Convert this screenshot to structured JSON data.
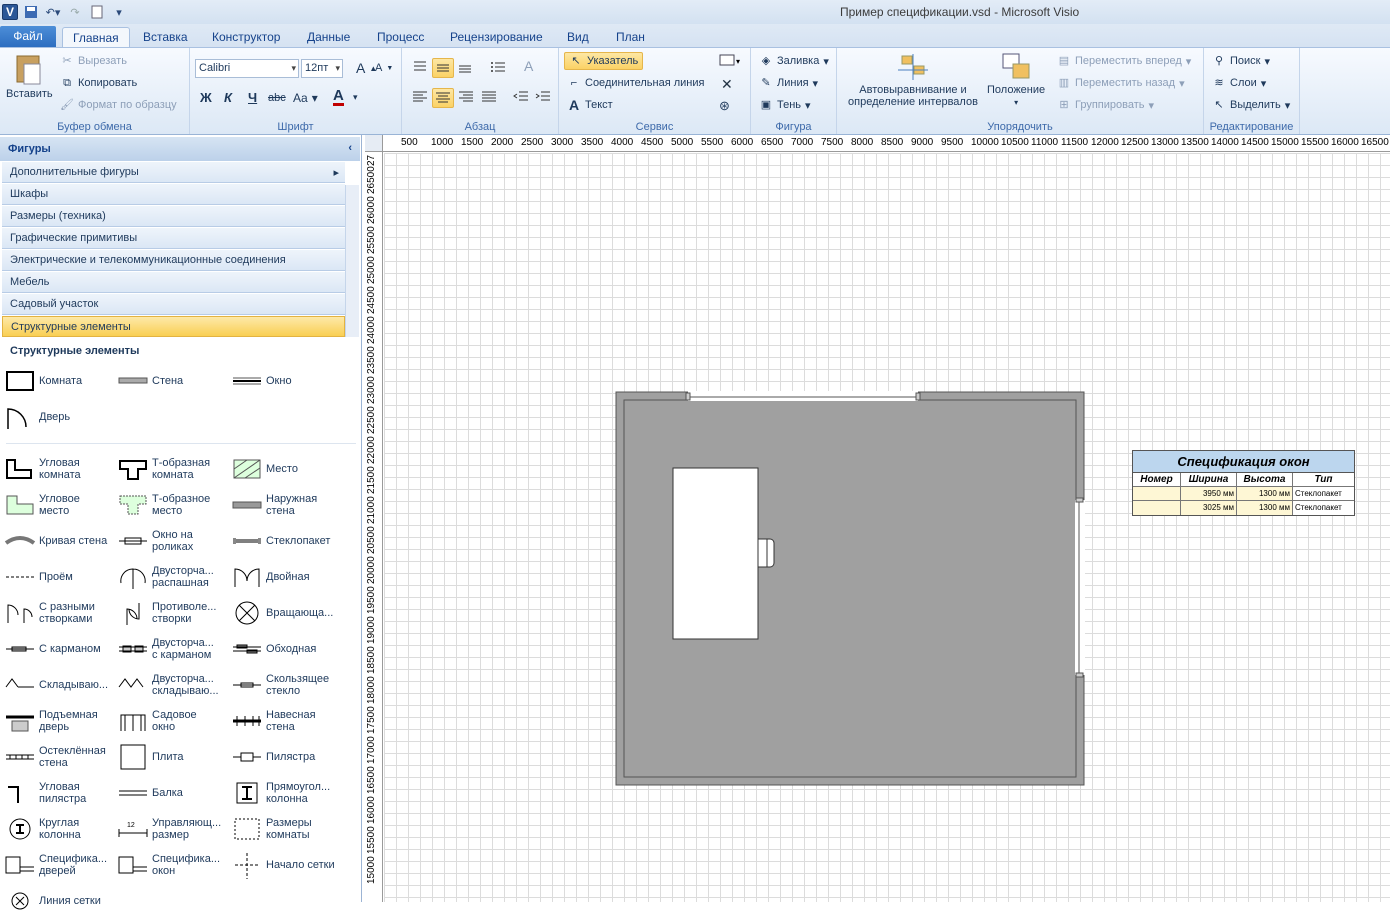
{
  "window": {
    "title": "Пример спецификации.vsd - Microsoft Visio"
  },
  "tabs": [
    "Файл",
    "Главная",
    "Вставка",
    "Конструктор",
    "Данные",
    "Процесс",
    "Рецензирование",
    "Вид",
    "План"
  ],
  "ribbon": {
    "clipboard": {
      "paste": "Вставить",
      "cut": "Вырезать",
      "copy": "Копировать",
      "format_painter": "Формат по образцу",
      "label": "Буфер обмена"
    },
    "font": {
      "family": "Calibri",
      "size": "12пт",
      "label": "Шрифт",
      "bold": "Ж",
      "italic": "К",
      "underline": "Ч",
      "strike": "abc",
      "case": "Aa",
      "color": "A"
    },
    "paragraph": {
      "label": "Абзац"
    },
    "tools": {
      "pointer": "Указатель",
      "connector": "Соединительная линия",
      "text": "Текст",
      "label": "Сервис"
    },
    "shape": {
      "fill": "Заливка",
      "line": "Линия",
      "shadow": "Тень",
      "label": "Фигура"
    },
    "arrange": {
      "auto_align": "Автовыравнивание и определение интервалов",
      "position": "Положение",
      "bring_forward": "Переместить вперед",
      "send_backward": "Переместить назад",
      "group": "Группировать",
      "label": "Упорядочить"
    },
    "editing": {
      "find": "Поиск",
      "layers": "Слои",
      "select": "Выделить",
      "label": "Редактирование"
    }
  },
  "stencil": {
    "header": "Фигуры",
    "items": [
      "Дополнительные фигуры",
      "Шкафы",
      "Размеры (техника)",
      "Графические примитивы",
      "Электрические и телекоммуникационные соединения",
      "Мебель",
      "Садовый участок",
      "Структурные элементы"
    ],
    "section_title": "Структурные элементы",
    "shapes": [
      [
        "Комната"
      ],
      [
        "Стена"
      ],
      [
        "Окно"
      ],
      [
        "Дверь"
      ],
      [
        "Угловая",
        "комната"
      ],
      [
        "Т-образная",
        "комната"
      ],
      [
        "Место"
      ],
      [
        "Угловое",
        "место"
      ],
      [
        "Т-образное",
        "место"
      ],
      [
        "Наружная",
        "стена"
      ],
      [
        "Кривая стена"
      ],
      [
        "Окно на",
        "роликах"
      ],
      [
        "Стеклопакет"
      ],
      [
        "Проём"
      ],
      [
        "Двусторча...",
        "распашная"
      ],
      [
        "Двойная"
      ],
      [
        "С разными",
        "створками"
      ],
      [
        "Противоле...",
        "створки"
      ],
      [
        "Вращающа..."
      ],
      [
        "С карманом"
      ],
      [
        "Двусторча...",
        "с карманом"
      ],
      [
        "Обходная"
      ],
      [
        "Складываю..."
      ],
      [
        "Двусторча...",
        "складываю..."
      ],
      [
        "Скользящее",
        "стекло"
      ],
      [
        "Подъемная",
        "дверь"
      ],
      [
        "Садовое",
        "окно"
      ],
      [
        "Навесная",
        "стена"
      ],
      [
        "Остеклённая",
        "стена"
      ],
      [
        "Плита"
      ],
      [
        "Пилястра"
      ],
      [
        "Угловая",
        "пилястра"
      ],
      [
        "Балка"
      ],
      [
        "Прямоугол...",
        "колонна"
      ],
      [
        "Круглая",
        "колонна"
      ],
      [
        "Управляющ...",
        "размер"
      ],
      [
        "Размеры",
        "комнаты"
      ],
      [
        "Специфика...",
        "дверей"
      ],
      [
        "Специфика...",
        "окон"
      ],
      [
        "Начало сетки"
      ],
      [
        "Линия сетки"
      ]
    ]
  },
  "ruler_top": [
    "500",
    "1000",
    "1500",
    "2000",
    "2500",
    "3000",
    "3500",
    "4000",
    "4500",
    "5000",
    "5500",
    "6000",
    "6500",
    "7000",
    "7500",
    "8000",
    "8500",
    "9000",
    "9500",
    "10000",
    "10500",
    "11000",
    "11500",
    "12000",
    "12500",
    "13000",
    "13500",
    "14000",
    "14500",
    "15000",
    "15500",
    "16000",
    "16500"
  ],
  "ruler_left": [
    "27",
    "26500",
    "26000",
    "25500",
    "25000",
    "24500",
    "24000",
    "23500",
    "23000",
    "22500",
    "22000",
    "21500",
    "21000",
    "20500",
    "20000",
    "19500",
    "19000",
    "18500",
    "18000",
    "17500",
    "17000",
    "16500",
    "16000",
    "15500",
    "15000"
  ],
  "spec_table": {
    "title": "Спецификация окон",
    "headers": [
      "Номер",
      "Ширина",
      "Высота",
      "Тип"
    ],
    "rows": [
      [
        "",
        "3950 мм",
        "1300 мм",
        "Стеклопакет"
      ],
      [
        "",
        "3025 мм",
        "1300 мм",
        "Стеклопакет"
      ]
    ]
  }
}
